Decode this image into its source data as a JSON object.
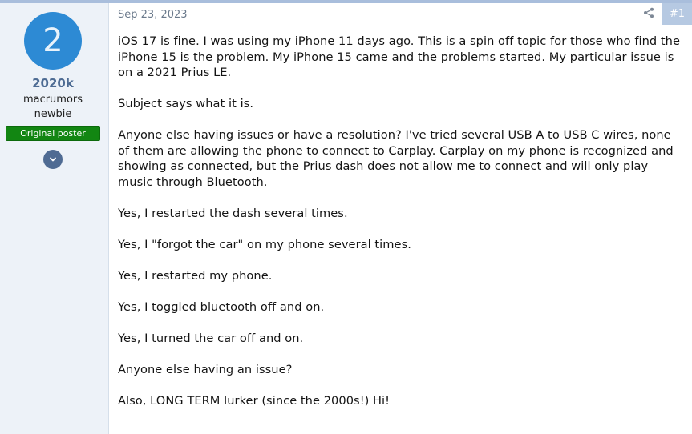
{
  "author": {
    "avatar_letter": "2",
    "username": "2020k",
    "title_line1": "macrumors",
    "title_line2": "newbie",
    "badge": "Original poster"
  },
  "post": {
    "date": "Sep 23, 2023",
    "number": "#1",
    "paragraphs": [
      "iOS 17 is fine. I was using my iPhone 11 days ago. This is a spin off topic for those who find the iPhone 15 is the problem. My iPhone 15 came and the problems started. My particular issue is on a 2021 Prius LE.",
      "Subject says what it is.",
      "Anyone else having issues or have a resolution? I've tried several USB A to USB C wires, none of them are allowing the phone to connect to Carplay. Carplay on my phone is recognized and showing as connected, but the Prius dash does not allow me to connect and will only play music through Bluetooth.",
      "Yes, I restarted the dash several times.",
      "Yes, I \"forgot the car\" on my phone several times.",
      "Yes, I restarted my phone.",
      "Yes, I toggled bluetooth off and on.",
      "Yes, I turned the car off and on.",
      "Anyone else having an issue?",
      "Also, LONG TERM lurker (since the 2000s!) Hi!"
    ]
  },
  "icons": {
    "share": "share-icon",
    "expand": "chevron-down-icon"
  },
  "colors": {
    "avatar_bg": "#2d8ad4",
    "username": "#4d6b93",
    "badge_bg": "#128612",
    "sidebar_bg": "#edf2f8",
    "post_number_bg": "#b6c9e2"
  }
}
